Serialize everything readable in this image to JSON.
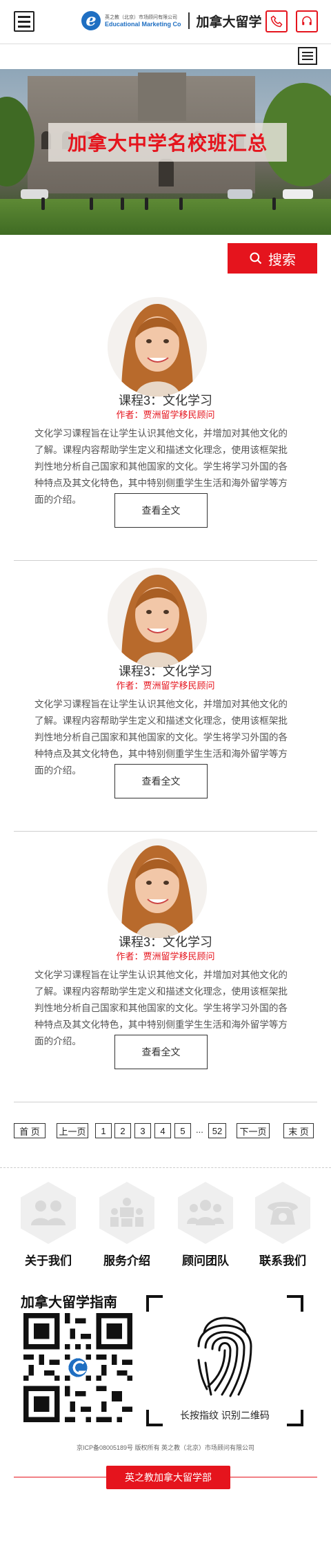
{
  "header": {
    "logo_cn": "英之教（北京）市场顾问有限公司",
    "logo_en": "Educational Marketing Co",
    "title": "加拿大留学",
    "menu_icon": "menu-icon",
    "phone_icon": "phone-icon",
    "service_icon": "headset-icon"
  },
  "banner": {
    "title": "加拿大中学名校班汇总"
  },
  "search": {
    "placeholder": "",
    "button_label": "搜索"
  },
  "articles": [
    {
      "title": "课程3：文化学习",
      "author": "作者：贾洲留学移民顾问",
      "description": "文化学习课程旨在让学生认识其他文化，并增加对其他文化的了解。课程内容帮助学生定义和描述文化理念，使用该框架批判性地分析自己国家和其他国家的文化。学生将学习外国的各种特点及其文化特色，其中特别侧重学生生活和海外留学等方面的介绍。",
      "more_label": "查看全文"
    },
    {
      "title": "课程3：文化学习",
      "author": "作者：贾洲留学移民顾问",
      "description": "文化学习课程旨在让学生认识其他文化，并增加对其他文化的了解。课程内容帮助学生定义和描述文化理念，使用该框架批判性地分析自己国家和其他国家的文化。学生将学习外国的各种特点及其文化特色，其中特别侧重学生生活和海外留学等方面的介绍。",
      "more_label": "查看全文"
    },
    {
      "title": "课程3：文化学习",
      "author": "作者：贾洲留学移民顾问",
      "description": "文化学习课程旨在让学生认识其他文化，并增加对其他文化的了解。课程内容帮助学生定义和描述文化理念，使用该框架批判性地分析自己国家和其他国家的文化。学生将学习外国的各种特点及其文化特色，其中特别侧重学生生活和海外留学等方面的介绍。",
      "more_label": "查看全文"
    }
  ],
  "pagination": {
    "first": "首 页",
    "prev": "上一页",
    "pages": [
      "1",
      "2",
      "3",
      "4",
      "5"
    ],
    "ellipsis": "...",
    "last_page": "52",
    "next": "下一页",
    "last": "末 页"
  },
  "footer": {
    "nav": [
      {
        "label": "关于我们",
        "icon": "team-icon"
      },
      {
        "label": "服务介绍",
        "icon": "meeting-icon"
      },
      {
        "label": "顾问团队",
        "icon": "group-icon"
      },
      {
        "label": "联系我们",
        "icon": "telephone-icon"
      }
    ],
    "guide_title": "加拿大留学指南",
    "fingerprint_text": "长按指纹 识别二维码",
    "copyright": "京ICP备08005189号 版权所有 英之教（北京）市场顾问有限公司",
    "bottom_button": "英之教加拿大留学部",
    "accent_color": "#e5141d"
  }
}
